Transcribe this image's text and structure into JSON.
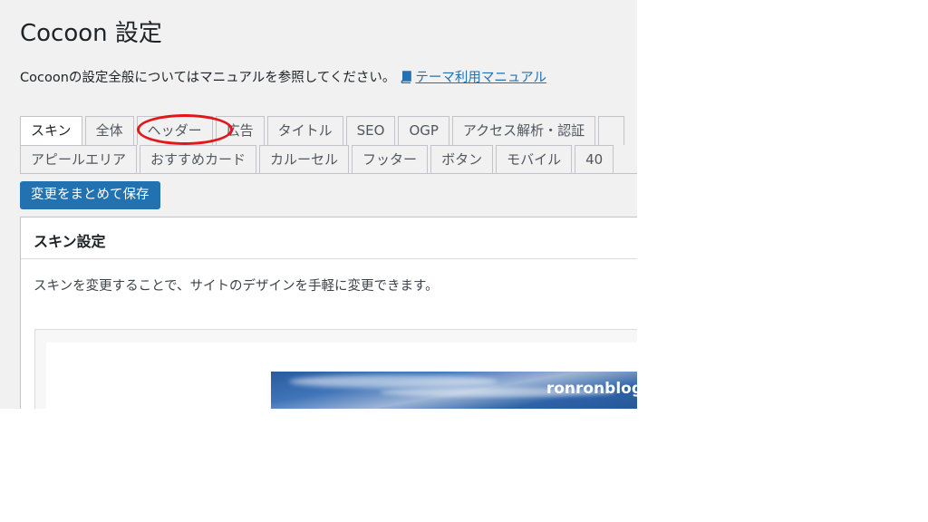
{
  "page": {
    "title": "Cocoon 設定",
    "intro_text": "Cocoonの設定全般についてはマニュアルを参照してください。",
    "manual_link": "テーマ利用マニュアル"
  },
  "tabs": {
    "row1": [
      "スキン",
      "全体",
      "ヘッダー",
      "広告",
      "タイトル",
      "SEO",
      "OGP",
      "アクセス解析・認証"
    ],
    "row2": [
      "アピールエリア",
      "おすすめカード",
      "カルーセル",
      "フッター",
      "ボタン",
      "モバイル",
      "40"
    ],
    "active": "スキン",
    "highlighted": "ヘッダー"
  },
  "save_button": "変更をまとめて保存",
  "panel": {
    "title": "スキン設定",
    "description": "スキンを変更することで、サイトのデザインを手軽に変更できます。",
    "preview_site_name": "ronronblog"
  },
  "colors": {
    "accent": "#2271b1",
    "highlight_ring": "#e3161b",
    "background": "#f1f1f1"
  }
}
